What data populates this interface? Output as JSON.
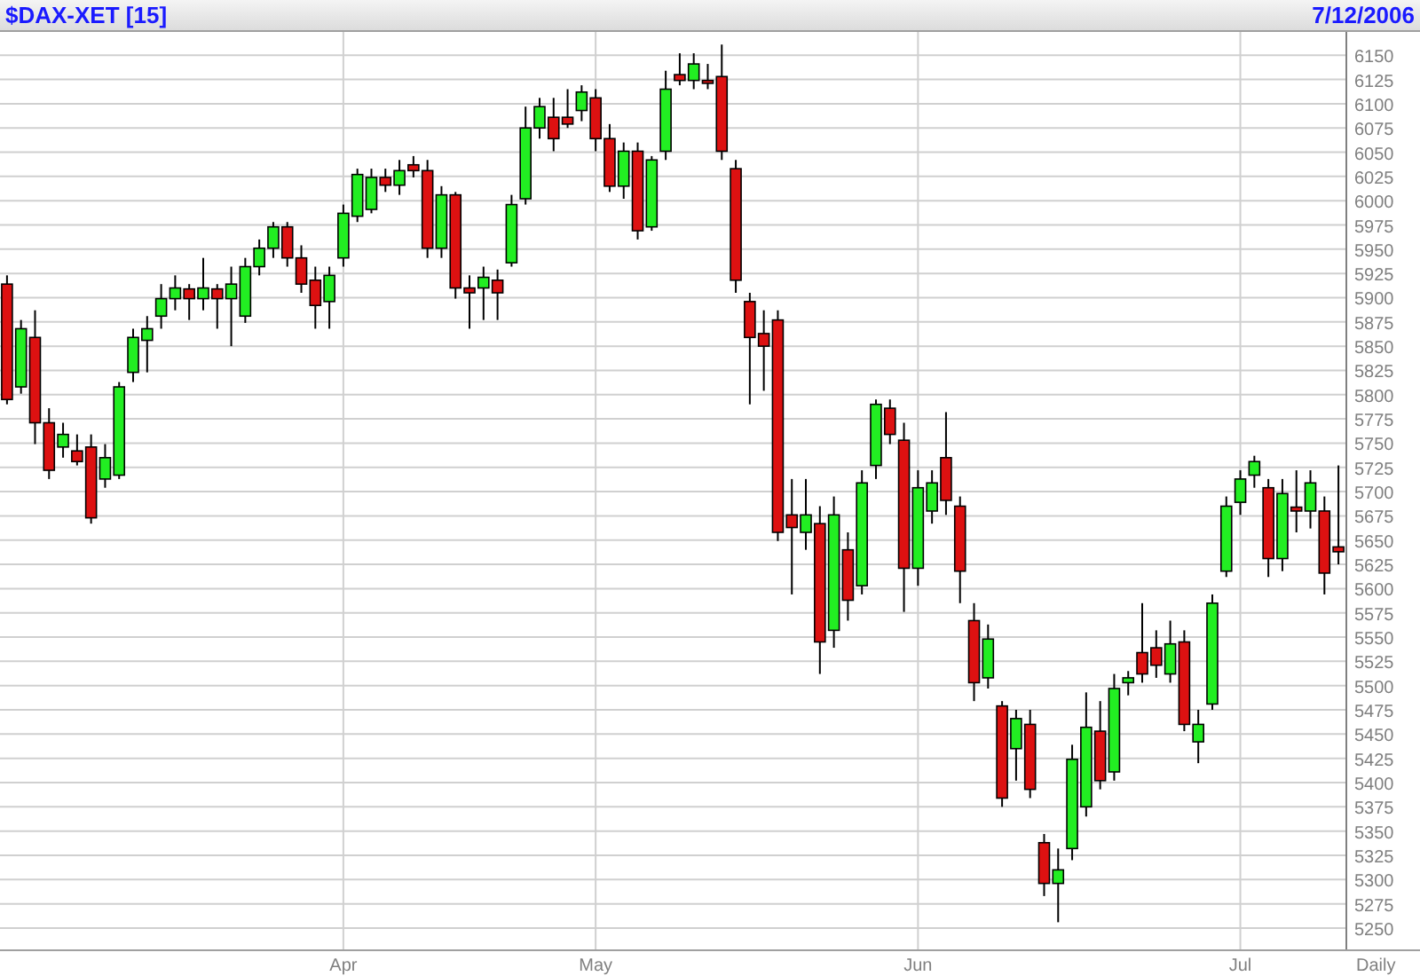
{
  "header": {
    "symbol": "$DAX-XET [15]",
    "date": "7/12/2006"
  },
  "chart": {
    "period": "Daily",
    "chart_data": {
      "type": "candlestick",
      "categories": [
        null,
        null,
        null,
        null,
        null,
        null,
        null,
        null,
        null,
        null,
        null,
        null,
        null,
        null,
        null,
        null,
        null,
        null,
        null,
        null,
        null,
        null,
        null,
        null,
        "Apr",
        null,
        null,
        null,
        null,
        null,
        null,
        null,
        null,
        null,
        null,
        null,
        null,
        null,
        null,
        null,
        null,
        null,
        "May",
        null,
        null,
        null,
        null,
        null,
        null,
        null,
        null,
        null,
        null,
        null,
        null,
        null,
        null,
        null,
        null,
        null,
        null,
        null,
        null,
        null,
        null,
        "Jun",
        null,
        null,
        null,
        null,
        null,
        null,
        null,
        null,
        null,
        null,
        null,
        null,
        null,
        null,
        null,
        null,
        null,
        null,
        null,
        null,
        null,
        null,
        "Jul",
        null,
        null,
        null,
        null,
        null,
        null,
        null
      ],
      "ohlc": [
        [
          5914,
          5923,
          5790,
          5795
        ],
        [
          5808,
          5877,
          5801,
          5868
        ],
        [
          5859,
          5887,
          5749,
          5771
        ],
        [
          5771,
          5786,
          5713,
          5722
        ],
        [
          5746,
          5771,
          5735,
          5759
        ],
        [
          5742,
          5759,
          5727,
          5731
        ],
        [
          5746,
          5759,
          5667,
          5673
        ],
        [
          5713,
          5749,
          5704,
          5735
        ],
        [
          5717,
          5813,
          5713,
          5808
        ],
        [
          5823,
          5868,
          5813,
          5859
        ],
        [
          5856,
          5881,
          5823,
          5868
        ],
        [
          5881,
          5914,
          5868,
          5899
        ],
        [
          5899,
          5923,
          5887,
          5910
        ],
        [
          5909,
          5914,
          5877,
          5899
        ],
        [
          5899,
          5941,
          5887,
          5910
        ],
        [
          5909,
          5914,
          5868,
          5899
        ],
        [
          5899,
          5932,
          5850,
          5914
        ],
        [
          5881,
          5941,
          5874,
          5932
        ],
        [
          5932,
          5960,
          5923,
          5951
        ],
        [
          5951,
          5978,
          5941,
          5973
        ],
        [
          5973,
          5978,
          5932,
          5941
        ],
        [
          5941,
          5954,
          5905,
          5914
        ],
        [
          5918,
          5932,
          5868,
          5892
        ],
        [
          5896,
          5932,
          5868,
          5923
        ],
        [
          5941,
          5996,
          5932,
          5987
        ],
        [
          5984,
          6033,
          5978,
          6027
        ],
        [
          5991,
          6033,
          5987,
          6024
        ],
        [
          6024,
          6033,
          6009,
          6016
        ],
        [
          6016,
          6042,
          6006,
          6031
        ],
        [
          6037,
          6046,
          6024,
          6031
        ],
        [
          6031,
          6042,
          5941,
          5951
        ],
        [
          5951,
          6015,
          5941,
          6006
        ],
        [
          6006,
          6009,
          5899,
          5910
        ],
        [
          5910,
          5923,
          5868,
          5905
        ],
        [
          5910,
          5932,
          5877,
          5921
        ],
        [
          5918,
          5929,
          5877,
          5905
        ],
        [
          5936,
          6006,
          5932,
          5996
        ],
        [
          6002,
          6097,
          5996,
          6075
        ],
        [
          6075,
          6106,
          6064,
          6097
        ],
        [
          6086,
          6106,
          6051,
          6064
        ],
        [
          6086,
          6115,
          6075,
          6079
        ],
        [
          6093,
          6119,
          6082,
          6112
        ],
        [
          6106,
          6115,
          6051,
          6064
        ],
        [
          6064,
          6079,
          6009,
          6015
        ],
        [
          6015,
          6060,
          6002,
          6051
        ],
        [
          6051,
          6060,
          5960,
          5969
        ],
        [
          5973,
          6046,
          5969,
          6042
        ],
        [
          6051,
          6134,
          6042,
          6115
        ],
        [
          6130,
          6152,
          6119,
          6124
        ],
        [
          6124,
          6152,
          6115,
          6141
        ],
        [
          6124,
          6141,
          6115,
          6121
        ],
        [
          6128,
          6161,
          6042,
          6051
        ],
        [
          6033,
          6042,
          5905,
          5918
        ],
        [
          5896,
          5905,
          5790,
          5859
        ],
        [
          5863,
          5887,
          5804,
          5850
        ],
        [
          5877,
          5887,
          5649,
          5658
        ],
        [
          5676,
          5713,
          5594,
          5663
        ],
        [
          5658,
          5713,
          5640,
          5676
        ],
        [
          5667,
          5685,
          5512,
          5545
        ],
        [
          5557,
          5695,
          5539,
          5676
        ],
        [
          5640,
          5658,
          5567,
          5588
        ],
        [
          5603,
          5722,
          5594,
          5709
        ],
        [
          5727,
          5795,
          5713,
          5790
        ],
        [
          5786,
          5795,
          5749,
          5759
        ],
        [
          5753,
          5771,
          5576,
          5621
        ],
        [
          5621,
          5722,
          5603,
          5704
        ],
        [
          5680,
          5722,
          5667,
          5709
        ],
        [
          5735,
          5782,
          5676,
          5691
        ],
        [
          5685,
          5695,
          5585,
          5618
        ],
        [
          5567,
          5585,
          5484,
          5503
        ],
        [
          5508,
          5563,
          5497,
          5548
        ],
        [
          5479,
          5484,
          5375,
          5384
        ],
        [
          5435,
          5475,
          5402,
          5466
        ],
        [
          5460,
          5475,
          5384,
          5393
        ],
        [
          5338,
          5347,
          5283,
          5296
        ],
        [
          5296,
          5332,
          5256,
          5310
        ],
        [
          5332,
          5439,
          5320,
          5424
        ],
        [
          5375,
          5493,
          5365,
          5457
        ],
        [
          5453,
          5484,
          5393,
          5402
        ],
        [
          5411,
          5512,
          5402,
          5497
        ],
        [
          5503,
          5515,
          5490,
          5508
        ],
        [
          5534,
          5585,
          5503,
          5512
        ],
        [
          5539,
          5557,
          5508,
          5521
        ],
        [
          5512,
          5567,
          5503,
          5543
        ],
        [
          5545,
          5557,
          5453,
          5460
        ],
        [
          5442,
          5475,
          5420,
          5460
        ],
        [
          5481,
          5594,
          5475,
          5585
        ],
        [
          5618,
          5695,
          5612,
          5685
        ],
        [
          5689,
          5722,
          5676,
          5713
        ],
        [
          5717,
          5737,
          5704,
          5731
        ],
        [
          5704,
          5713,
          5612,
          5631
        ],
        [
          5631,
          5713,
          5618,
          5698
        ],
        [
          5684,
          5722,
          5658,
          5680
        ],
        [
          5680,
          5722,
          5662,
          5709
        ],
        [
          5680,
          5695,
          5594,
          5616
        ],
        [
          5643,
          5727,
          5625,
          5638
        ]
      ],
      "ylim": [
        5228,
        6174
      ],
      "grid": true,
      "yticks": [
        6150,
        6125,
        6100,
        6075,
        6050,
        6025,
        6000,
        5975,
        5950,
        5925,
        5900,
        5875,
        5850,
        5825,
        5800,
        5775,
        5750,
        5725,
        5700,
        5675,
        5650,
        5625,
        5600,
        5575,
        5550,
        5525,
        5500,
        5475,
        5450,
        5425,
        5400,
        5375,
        5350,
        5325,
        5300,
        5275,
        5250
      ]
    }
  }
}
